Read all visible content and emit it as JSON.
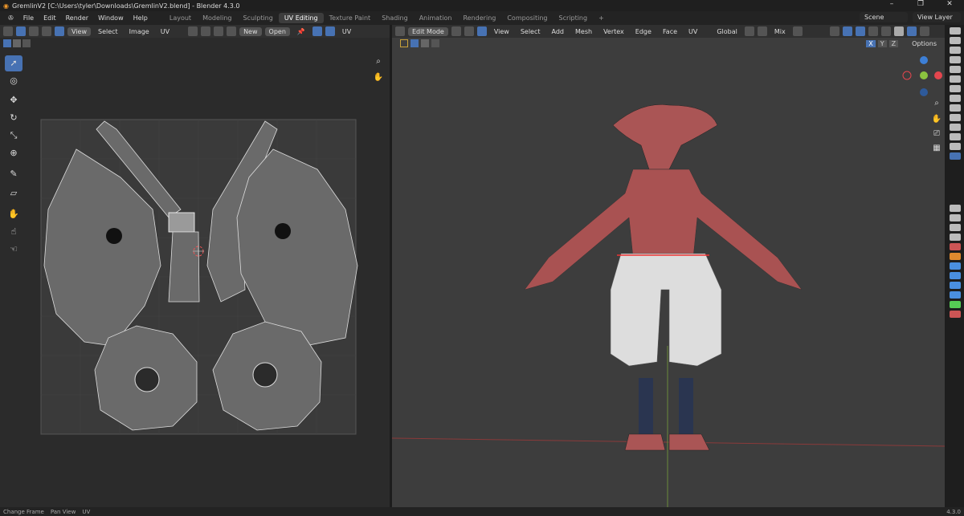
{
  "title": "GremlinV2 [C:\\Users\\tyler\\Downloads\\GremlinV2.blend] - Blender 4.3.0",
  "menu": [
    "File",
    "Edit",
    "Render",
    "Window",
    "Help"
  ],
  "workspaces": [
    "Layout",
    "Modeling",
    "Sculpting",
    "UV Editing",
    "Texture Paint",
    "Shading",
    "Animation",
    "Rendering",
    "Compositing",
    "Scripting",
    "+"
  ],
  "scene": "Scene",
  "view_layer": "View Layer",
  "uv_header": {
    "view": "View",
    "select": "Select",
    "image": "Image",
    "uv": "UV",
    "new": "New",
    "open": "Open",
    "uv_label": "UV"
  },
  "vp_header": {
    "mode": "Edit Mode",
    "view": "View",
    "select": "Select",
    "add": "Add",
    "mesh": "Mesh",
    "vertex": "Vertex",
    "edge": "Edge",
    "face": "Face",
    "uv": "UV",
    "orientation": "Global",
    "snap": "Mix",
    "x": "X",
    "y": "Y",
    "z": "Z",
    "options": "Options"
  },
  "status": [
    "Change Frame",
    "Pan View",
    "UV"
  ],
  "version": "4.3.0",
  "colors": {
    "accent": "#4772b3",
    "axis_x": "#e4464e",
    "axis_y": "#8bc43f",
    "axis_z": "#3d7fd6"
  }
}
